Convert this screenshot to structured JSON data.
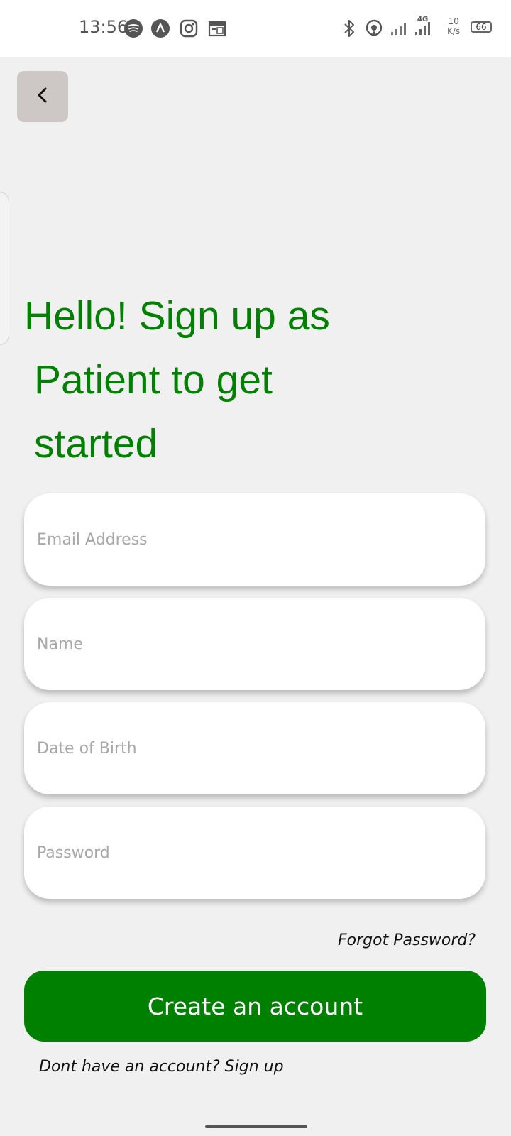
{
  "status_bar": {
    "time": "13:56",
    "left_icons": [
      "spotify-icon",
      "arc-icon",
      "instagram-icon",
      "calendar-icon"
    ],
    "right_icons": [
      "bluetooth-icon",
      "hotspot-icon",
      "signal-icon",
      "signal-4g-icon"
    ],
    "network_type": "4G",
    "speed_value": "10",
    "speed_unit": "K/s",
    "battery": "66"
  },
  "header": {
    "back_icon": "chevron-left-icon"
  },
  "headline": {
    "line1": "Hello! Sign up as",
    "line2": "Patient to get",
    "line3": "started"
  },
  "form": {
    "email_placeholder": "Email Address",
    "name_placeholder": "Name",
    "dob_placeholder": "Date of Birth",
    "password_placeholder": "Password"
  },
  "links": {
    "forgot_password": "Forgot Password?",
    "signup_prompt": "Dont have an account? Sign up"
  },
  "buttons": {
    "create_account": "Create an account"
  },
  "colors": {
    "accent": "#008000",
    "background": "#f0f0f0",
    "back_button": "#cdc8c5"
  }
}
